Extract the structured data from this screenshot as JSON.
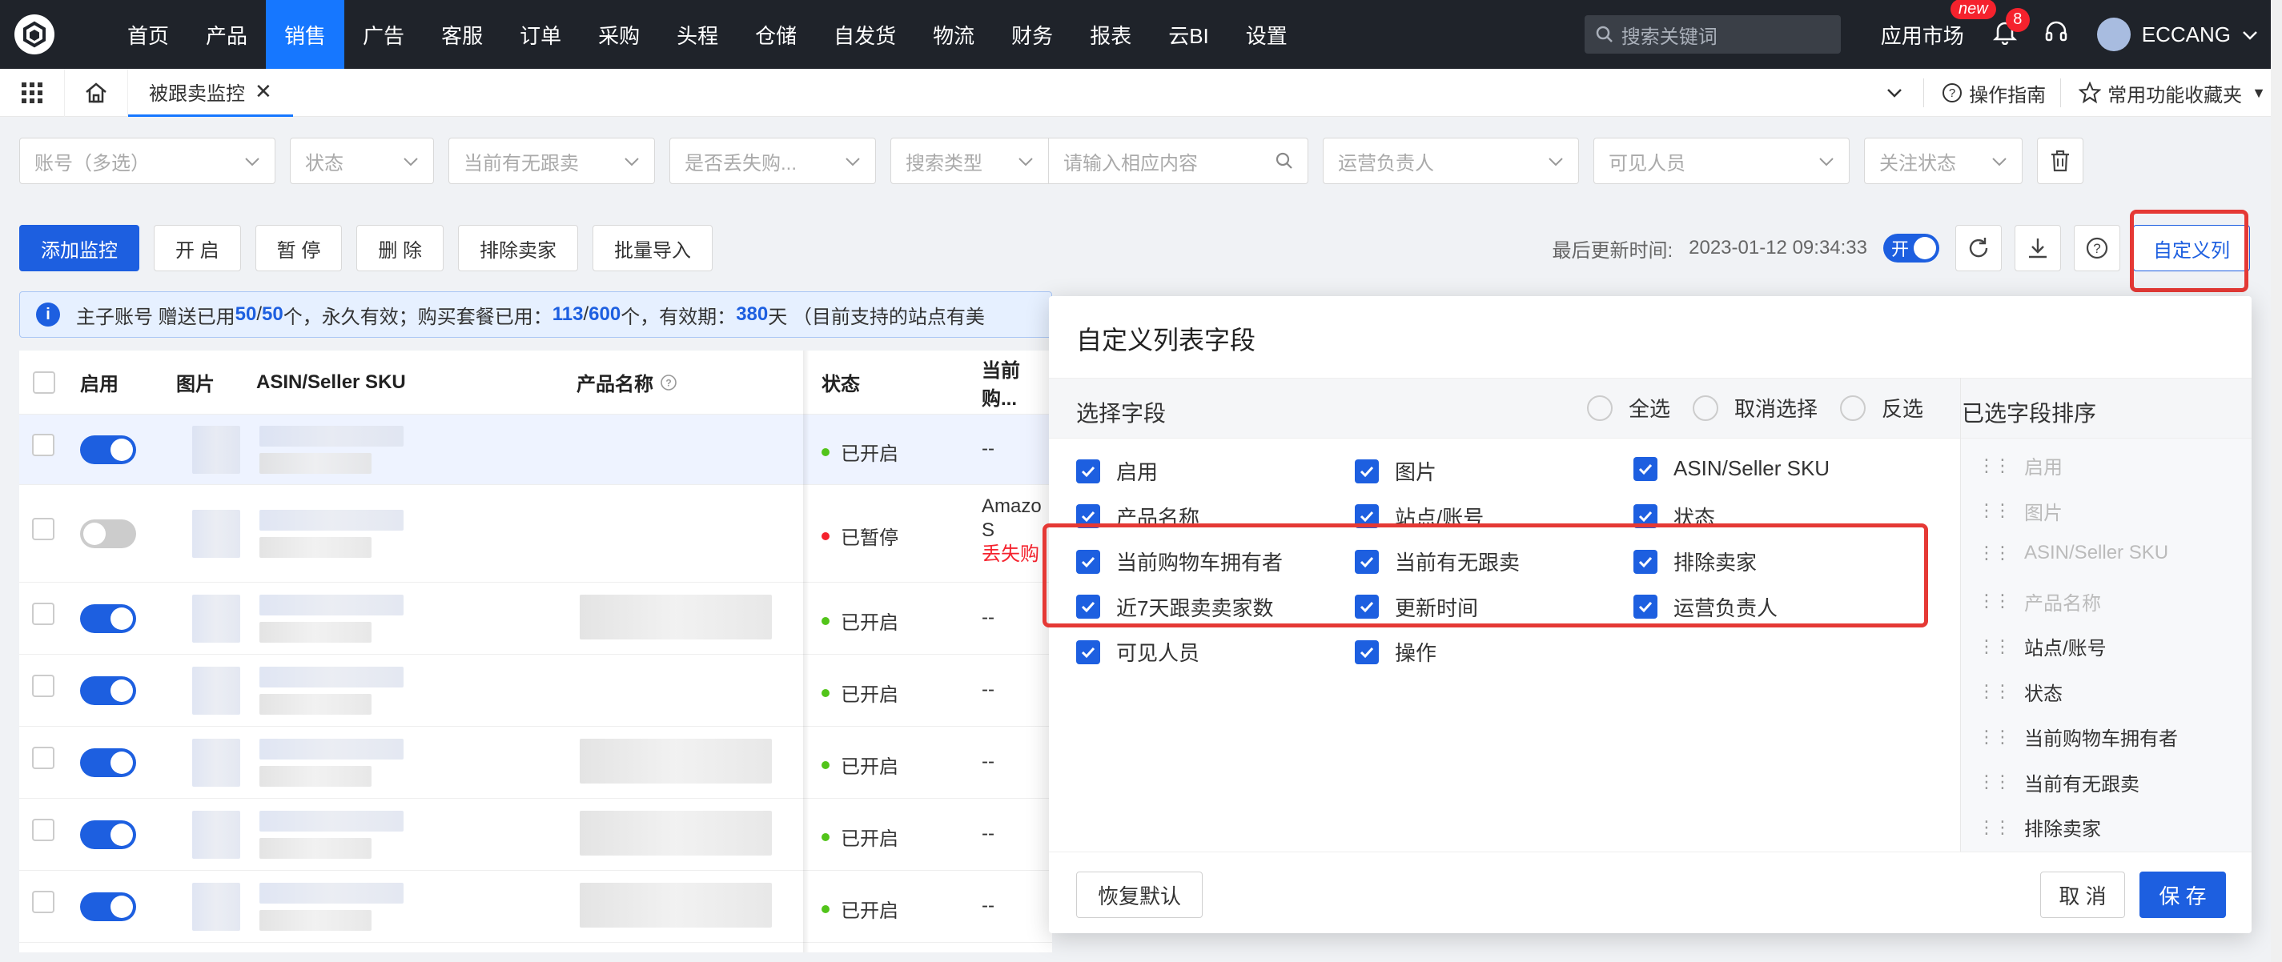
{
  "nav": {
    "items": [
      "首页",
      "产品",
      "销售",
      "广告",
      "客服",
      "订单",
      "采购",
      "头程",
      "仓储",
      "自发货",
      "物流",
      "财务",
      "报表",
      "云BI",
      "设置"
    ],
    "active_index": 2,
    "search_placeholder": "搜索关键词",
    "app_market": "应用市场",
    "new_badge": "new",
    "bell_count": "8",
    "username": "ECCANG"
  },
  "tabbar": {
    "tab_label": "被跟卖监控",
    "guide": "操作指南",
    "favorites": "常用功能收藏夹"
  },
  "filters": {
    "account": "账号（多选）",
    "status": "状态",
    "has_follow": "当前有无跟卖",
    "lost_cart": "是否丢失购...",
    "search_type": "搜索类型",
    "search_input": "请输入相应内容",
    "operator": "运营负责人",
    "visible": "可见人员",
    "follow_status": "关注状态"
  },
  "actions": {
    "add": "添加监控",
    "open": "开 启",
    "pause": "暂 停",
    "delete": "删 除",
    "exclude": "排除卖家",
    "import": "批量导入",
    "updated_label": "最后更新时间:",
    "updated_time": "2023-01-12 09:34:33",
    "toggle_label": "开",
    "custom_columns": "自定义列"
  },
  "info": {
    "text1": "主子账号 赠送已用 ",
    "gift_used": "50",
    "slash1": "/",
    "gift_total": "50",
    "text2": "个，永久有效；购买套餐已用：",
    "bought_used": "113",
    "slash2": "/",
    "bought_total": "600",
    "text3": "个，有效期：",
    "days": "380",
    "text4": "天 （目前支持的站点有美"
  },
  "table": {
    "headers": [
      "启用",
      "图片",
      "ASIN/Seller SKU",
      "产品名称",
      "状态",
      "当前购..."
    ],
    "rows": [
      {
        "enabled": true,
        "status": "已开启",
        "status_color": "#52c41a",
        "cart": "--"
      },
      {
        "enabled": false,
        "status": "已暂停",
        "status_color": "#f5222d",
        "cart": "Amazo",
        "cart2": "S",
        "cart3": "丢失购"
      },
      {
        "enabled": true,
        "status": "已开启",
        "status_color": "#52c41a",
        "cart": "--"
      },
      {
        "enabled": true,
        "status": "已开启",
        "status_color": "#52c41a",
        "cart": "--"
      },
      {
        "enabled": true,
        "status": "已开启",
        "status_color": "#52c41a",
        "cart": "--"
      },
      {
        "enabled": true,
        "status": "已开启",
        "status_color": "#52c41a",
        "cart": "--"
      },
      {
        "enabled": true,
        "status": "已开启",
        "status_color": "#52c41a",
        "cart": "--"
      }
    ]
  },
  "modal": {
    "title": "自定义列表字段",
    "select_label": "选择字段",
    "select_all": "全选",
    "deselect": "取消选择",
    "invert": "反选",
    "sorted_label": "已选字段排序",
    "fields": [
      "启用",
      "图片",
      "ASIN/Seller SKU",
      "产品名称",
      "站点/账号",
      "状态",
      "当前购物车拥有者",
      "当前有无跟卖",
      "排除卖家",
      "近7天跟卖卖家数",
      "更新时间",
      "运营负责人",
      "可见人员",
      "操作"
    ],
    "sorted": [
      {
        "label": "启用",
        "fixed": true
      },
      {
        "label": "图片",
        "fixed": true
      },
      {
        "label": "ASIN/Seller SKU",
        "fixed": true
      },
      {
        "label": "产品名称",
        "fixed": true
      },
      {
        "label": "站点/账号",
        "fixed": false
      },
      {
        "label": "状态",
        "fixed": false
      },
      {
        "label": "当前购物车拥有者",
        "fixed": false
      },
      {
        "label": "当前有无跟卖",
        "fixed": false
      },
      {
        "label": "排除卖家",
        "fixed": false
      }
    ],
    "reset": "恢复默认",
    "cancel": "取 消",
    "save": "保 存"
  },
  "colors": {
    "accent": "#1d5fe0",
    "nav_bg": "#1f232a",
    "highlight": "#e53935"
  }
}
